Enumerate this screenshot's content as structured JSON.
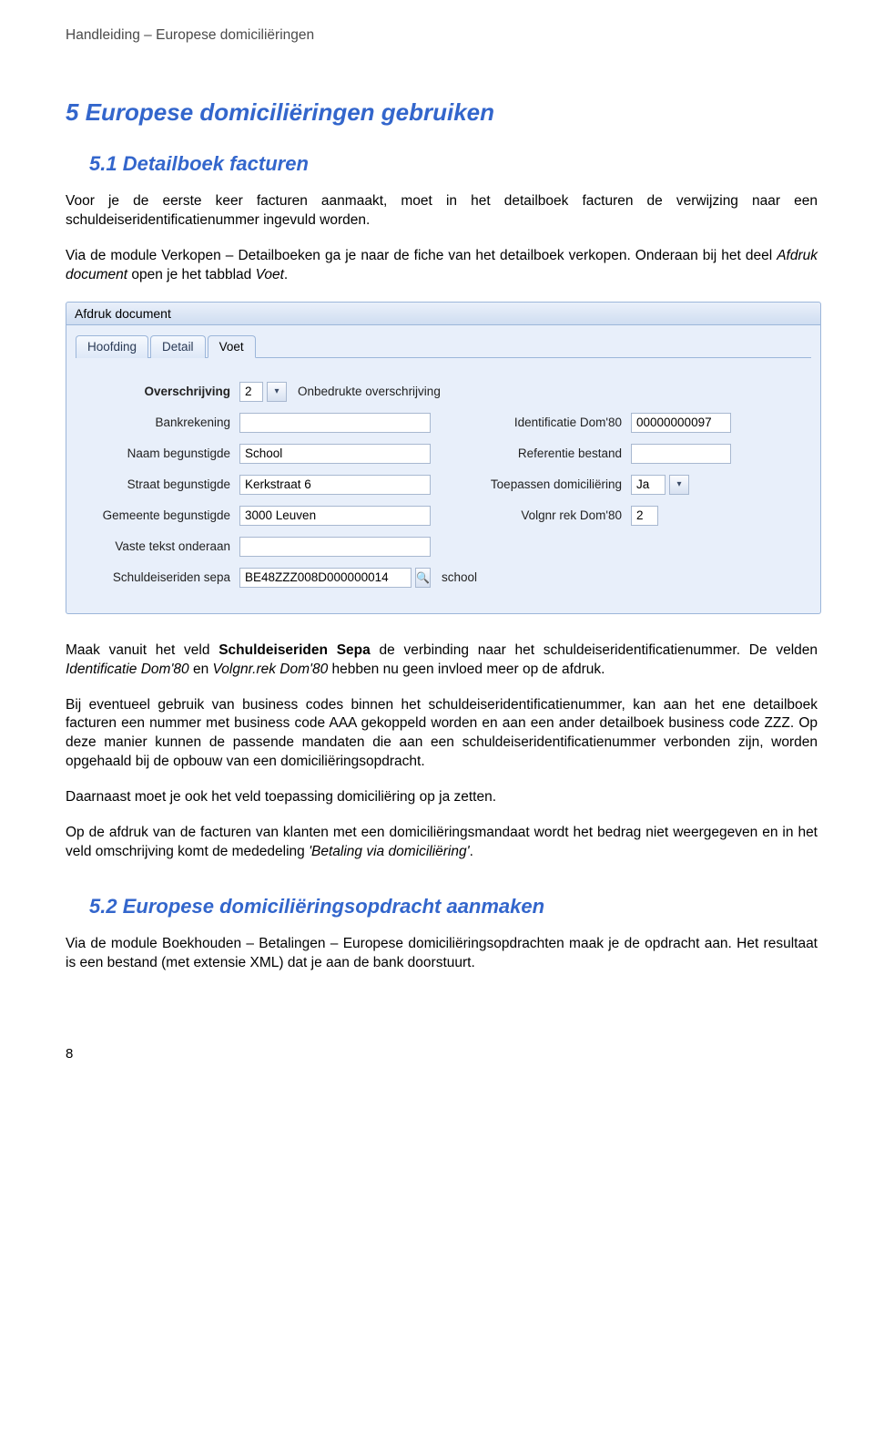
{
  "doc_header": "Handleiding – Europese domiciliëringen",
  "h1": {
    "num": "5",
    "text": "Europese domiciliëringen gebruiken"
  },
  "h2a": {
    "num": "5.1",
    "text": "Detailboek facturen"
  },
  "intro": "Voor je de eerste keer facturen aanmaakt, moet in het detailboek facturen de verwijzing naar een schuldeiseridentificatienummer ingevuld worden.",
  "intro2a": "Via de module Verkopen – Detailboeken ga je naar de fiche van het detailboek verkopen. Onderaan bij het deel ",
  "intro2b_em": "Afdruk document",
  "intro2c": " open je het tabblad ",
  "intro2d_em": "Voet",
  "intro2e": ".",
  "panel": {
    "title": "Afdruk document",
    "tabs": [
      "Hoofding",
      "Detail",
      "Voet"
    ],
    "active_tab": 2,
    "labels": {
      "overschrijving": "Overschrijving",
      "overschrijving_desc": "Onbedrukte overschrijving",
      "bankrekening": "Bankrekening",
      "identificatie": "Identificatie Dom'80",
      "naam_beg": "Naam begunstigde",
      "ref_bestand": "Referentie bestand",
      "straat_beg": "Straat begunstigde",
      "toepassen": "Toepassen domiciliëring",
      "gemeente_beg": "Gemeente begunstigde",
      "volgnr": "Volgnr rek Dom'80",
      "vaste_tekst": "Vaste tekst onderaan",
      "schuldeiser": "Schuldeiseriden sepa",
      "schuldeiser_lookup": "school"
    },
    "values": {
      "overschrijving": "2",
      "bankrekening": "",
      "identificatie": "00000000097",
      "naam_beg": "School",
      "ref_bestand": "",
      "straat_beg": "Kerkstraat 6",
      "toepassen": "Ja",
      "gemeente_beg": "3000 Leuven",
      "volgnr": "2",
      "vaste_tekst": "",
      "schuldeiser": "BE48ZZZ008D000000014"
    }
  },
  "para_after_1a": "Maak vanuit het veld ",
  "para_after_1b_strong": "Schuldeiseriden Sepa",
  "para_after_1c": " de verbinding naar het schuldeiseridentificatienummer. De velden ",
  "para_after_1d_em": "Identificatie Dom'80",
  "para_after_1e": " en ",
  "para_after_1f_em": "Volgnr.rek Dom'80",
  "para_after_1g": " hebben nu geen invloed meer op de afdruk.",
  "para_after_2": "Bij eventueel gebruik van business codes binnen het schuldeiseridentificatienummer, kan aan het ene detailboek facturen een nummer met business code AAA gekoppeld worden en aan een ander detailboek business code ZZZ. Op deze manier kunnen de passende mandaten die aan een schuldeiseridentificatienummer verbonden zijn, worden opgehaald bij de opbouw van een domiciliëringsopdracht.",
  "para_after_3": "Daarnaast moet je ook het veld toepassing domiciliëring op ja zetten.",
  "para_after_4a": "Op de afdruk van de facturen van klanten met een domiciliëringsmandaat wordt het bedrag niet weergegeven en in het veld omschrijving komt de mededeling ",
  "para_after_4b_em": "'Betaling via domiciliëring'",
  "para_after_4c": ".",
  "h2b": {
    "num": "5.2",
    "text": "Europese domiciliëringsopdracht aanmaken"
  },
  "para_52": "Via de module Boekhouden – Betalingen – Europese domiciliëringsopdrachten maak je de opdracht aan. Het resultaat is een bestand (met extensie XML) dat je aan de bank doorstuurt.",
  "page_number": "8"
}
